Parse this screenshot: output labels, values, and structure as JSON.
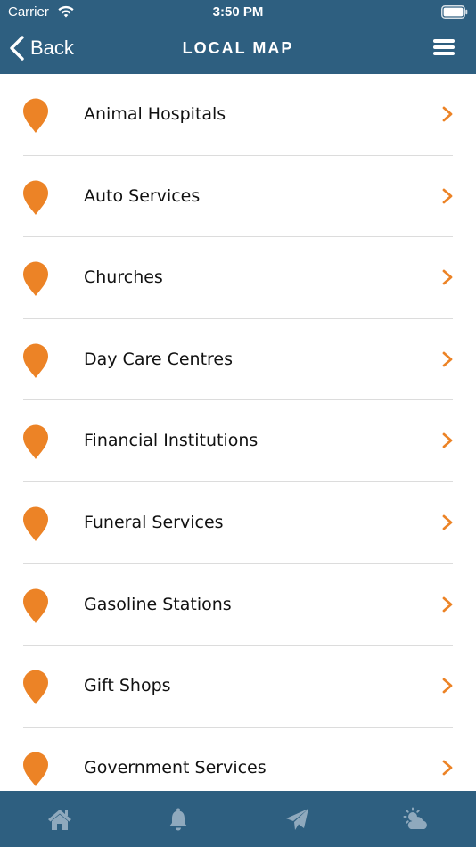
{
  "status_bar": {
    "carrier": "Carrier",
    "time": "3:50 PM",
    "wifi_icon": "wifi-icon",
    "battery_icon": "battery-icon"
  },
  "nav": {
    "back_label": "Back",
    "title": "LOCAL MAP",
    "menu_icon": "hamburger-menu-icon"
  },
  "list": {
    "items": [
      {
        "label": "Animal Hospitals"
      },
      {
        "label": "Auto Services"
      },
      {
        "label": "Churches"
      },
      {
        "label": "Day Care Centres"
      },
      {
        "label": "Financial Institutions"
      },
      {
        "label": "Funeral Services"
      },
      {
        "label": "Gasoline Stations"
      },
      {
        "label": "Gift Shops"
      },
      {
        "label": "Government Services"
      }
    ]
  },
  "tab_bar": {
    "tabs": [
      {
        "icon": "home-icon"
      },
      {
        "icon": "bell-icon"
      },
      {
        "icon": "paper-plane-icon"
      },
      {
        "icon": "weather-icon"
      }
    ]
  },
  "colors": {
    "header_bg": "#2e5f80",
    "accent_orange": "#ec8326",
    "tab_icon": "#8fa9bd",
    "divider": "#dcdcdc"
  }
}
